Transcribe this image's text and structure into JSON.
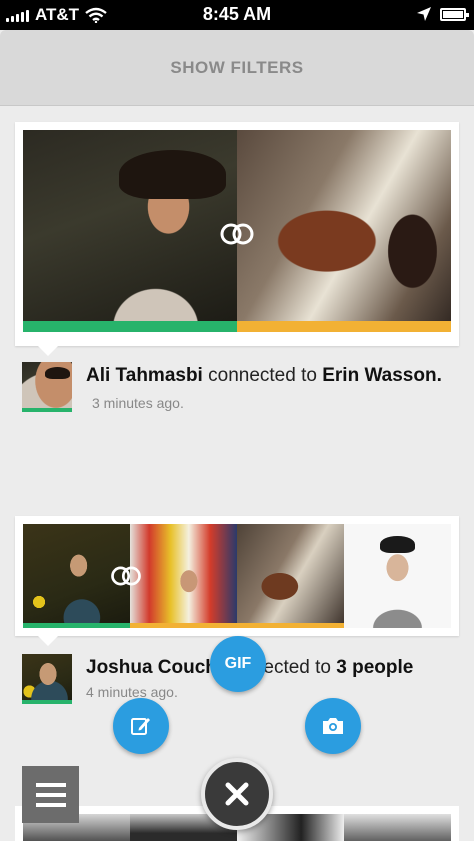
{
  "status_bar": {
    "carrier": "AT&T",
    "time": "8:45 AM"
  },
  "filters": {
    "label": "SHOW FILTERS"
  },
  "feed": [
    {
      "actor": "Ali Tahmasbi",
      "verb": "connected to",
      "target": "Erin Wasson.",
      "time": "3 minutes ago."
    },
    {
      "actor": "Joshua Couch",
      "verb": "connected to",
      "target": "3 people",
      "time": "4 minutes ago."
    }
  ],
  "actions": {
    "gif_label": "GIF"
  },
  "colors": {
    "accent_blue": "#2b9de0",
    "green": "#27b36b",
    "yellow": "#f2b134",
    "background": "#ececec"
  },
  "icons": [
    "signal-icon",
    "wifi-icon",
    "location-arrow-icon",
    "battery-icon",
    "connect-rings-icon",
    "pencil-icon",
    "camera-icon",
    "close-icon",
    "menu-icon"
  ]
}
